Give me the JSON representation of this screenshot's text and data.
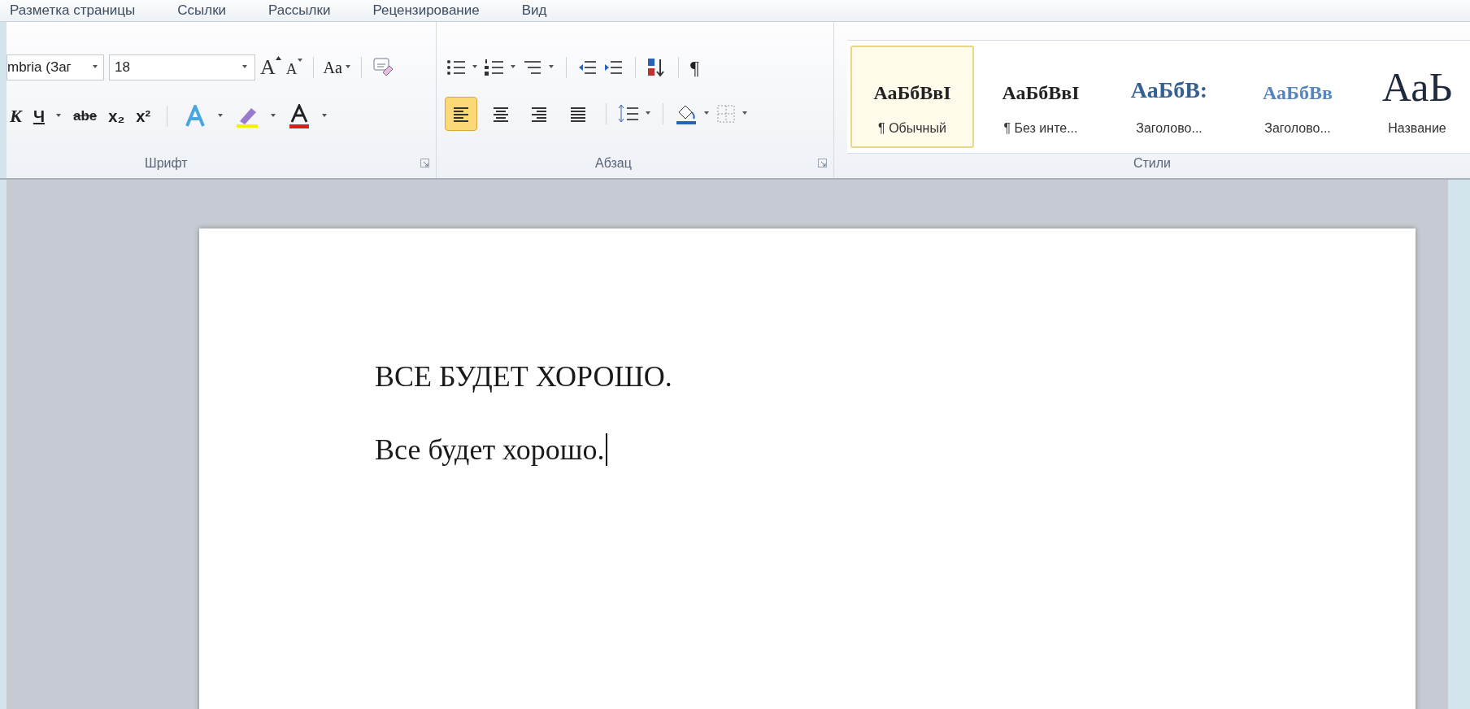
{
  "tabs": [
    {
      "label": "Разметка страницы",
      "selected": false
    },
    {
      "label": "Ссылки",
      "selected": false
    },
    {
      "label": "Рассылки",
      "selected": false
    },
    {
      "label": "Рецензирование",
      "selected": false
    },
    {
      "label": "Вид",
      "selected": false
    }
  ],
  "font_group": {
    "font_name": "mbria (Заг",
    "font_size": "18",
    "grow_button": "A",
    "shrink_button": "A",
    "case_button": "Aa",
    "format_buttons": [
      {
        "kind": "italic",
        "label": "К"
      },
      {
        "kind": "underline",
        "label": "Ч"
      },
      {
        "kind": "strike",
        "label": "abe"
      },
      {
        "kind": "sub",
        "label": "x₂"
      },
      {
        "kind": "sup",
        "label": "x²"
      }
    ],
    "label": "Шрифт"
  },
  "paragraph_group": {
    "pilcrow": "¶",
    "alignments": [
      {
        "kind": "left",
        "selected": true
      },
      {
        "kind": "center",
        "selected": false
      },
      {
        "kind": "right",
        "selected": false
      },
      {
        "kind": "justify",
        "selected": false
      }
    ],
    "label": "Абзац"
  },
  "styles_group": {
    "styles": [
      {
        "kind": "normal",
        "preview": "АаБбВвI",
        "name": "¶ Обычный",
        "selected": true
      },
      {
        "kind": "normal",
        "preview": "АаБбВвI",
        "name": "¶ Без инте...",
        "selected": false
      },
      {
        "kind": "heading1",
        "preview": "АаБбВ:",
        "name": "Заголово...",
        "selected": false
      },
      {
        "kind": "heading2",
        "preview": "АаБбВв",
        "name": "Заголово...",
        "selected": false
      },
      {
        "kind": "title",
        "preview": "АаЬ",
        "name": "Название",
        "selected": false
      }
    ],
    "label": "Стили"
  },
  "document": {
    "lines": [
      {
        "text": "ВСЕ БУДЕТ ХОРОШО.",
        "caret": false
      },
      {
        "text": "Все будет хорошо.",
        "caret": true
      }
    ]
  }
}
